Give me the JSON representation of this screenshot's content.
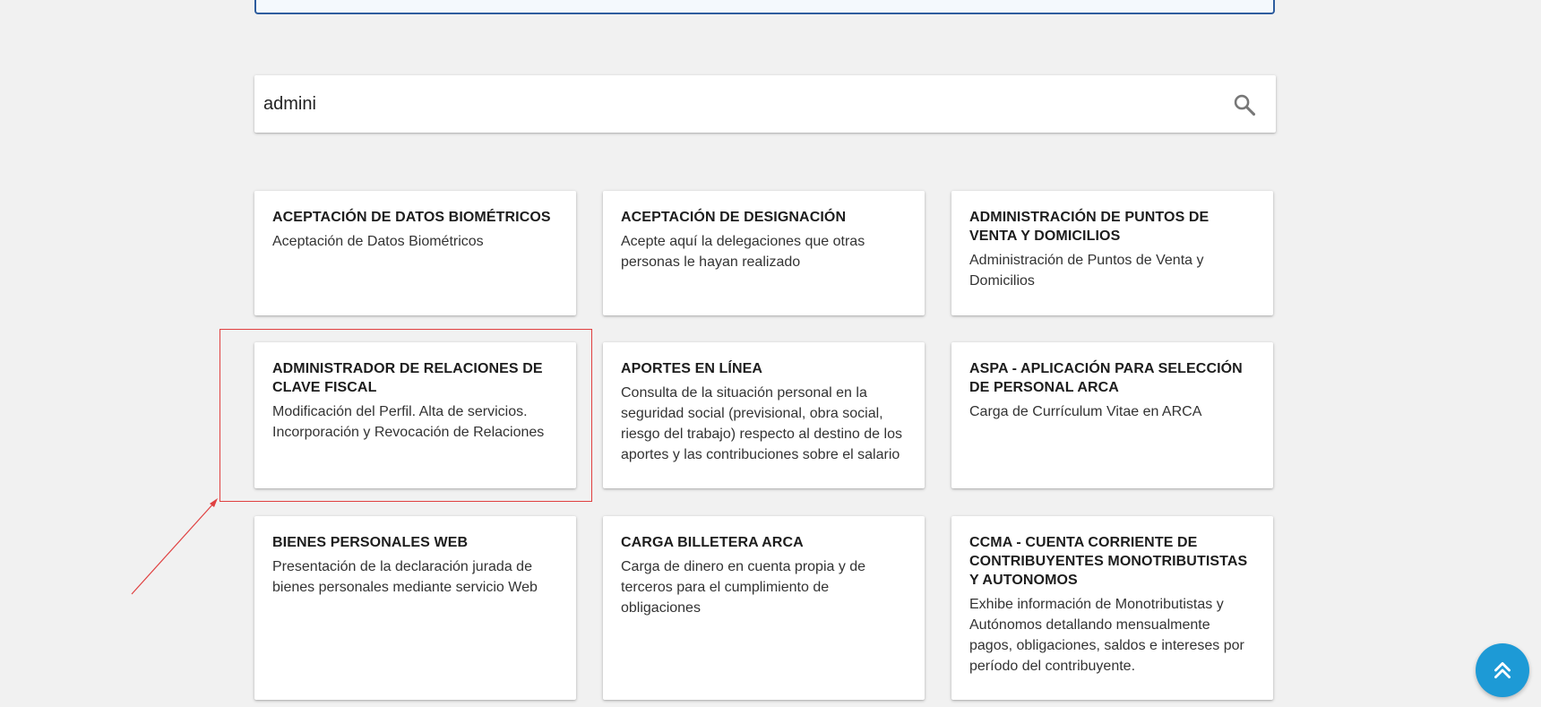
{
  "search": {
    "value": "admini",
    "icon": "search-icon"
  },
  "cards": [
    {
      "title": "ACEPTACIÓN DE DATOS BIOMÉTRICOS",
      "desc": "Aceptación de Datos Biométricos"
    },
    {
      "title": "ACEPTACIÓN DE DESIGNACIÓN",
      "desc": "Acepte aquí la delegaciones que otras personas le hayan realizado"
    },
    {
      "title": "ADMINISTRACIÓN DE PUNTOS DE VENTA Y DOMICILIOS",
      "desc": "Administración de Puntos de Venta y Domicilios"
    },
    {
      "title": "ADMINISTRADOR DE RELACIONES DE CLAVE FISCAL",
      "desc": "Modificación del Perfil. Alta de servicios. Incorporación y Revocación de Relaciones"
    },
    {
      "title": "APORTES EN LÍNEA",
      "desc": "Consulta de la situación personal en la seguridad social (previsional, obra social, riesgo del trabajo) respecto al destino de los aportes y las contribuciones sobre el salario"
    },
    {
      "title": "ASPA - APLICACIÓN PARA SELECCIÓN DE PERSONAL ARCA",
      "desc": "Carga de Currículum Vitae en ARCA"
    },
    {
      "title": "BIENES PERSONALES WEB",
      "desc": "Presentación de la declaración jurada de bienes personales mediante servicio Web"
    },
    {
      "title": "CARGA BILLETERA ARCA",
      "desc": "Carga de dinero en cuenta propia y de terceros para el cumplimiento de obligaciones"
    },
    {
      "title": "CCMA - CUENTA CORRIENTE DE CONTRIBUYENTES MONOTRIBUTISTAS Y AUTONOMOS",
      "desc": "Exhibe información de Monotributistas y Autónomos detallando mensualmente pagos, obligaciones, saldos e intereses por período del contribuyente."
    }
  ],
  "annotation": {
    "highlight_color": "#e04040",
    "highlighted_card": "ADMINISTRADOR DE RELACIONES DE CLAVE FISCAL"
  },
  "fab": {
    "icon": "double-chevron-up-icon",
    "color": "#1d9ad6"
  }
}
